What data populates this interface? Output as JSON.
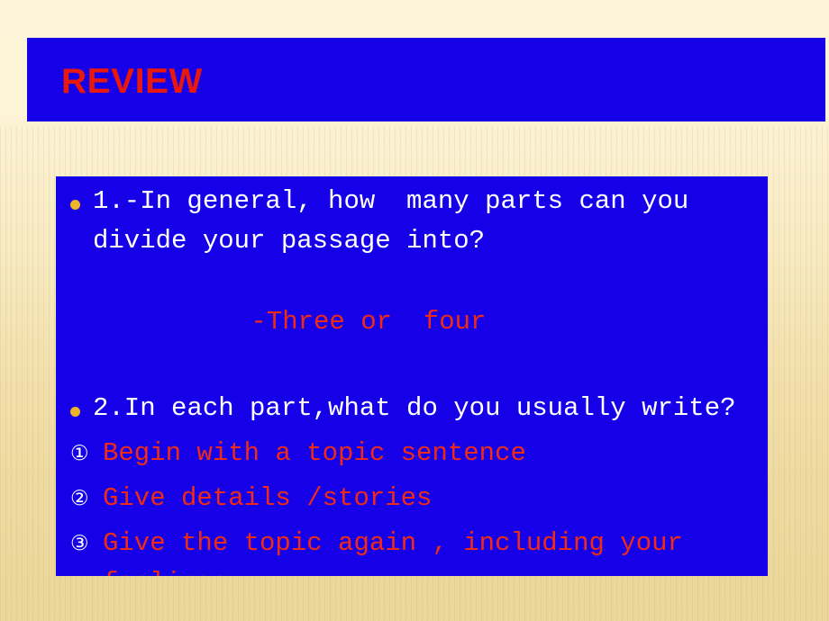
{
  "slide": {
    "title": "REVIEW",
    "colors": {
      "background": "#f5e6bd",
      "panel": "#1500e8",
      "title_text": "#e8180c",
      "body_white": "#ffffff",
      "body_red": "#ef2b16",
      "bullet_dot": "#f0b428"
    },
    "content": {
      "question1": "1.-In general, how  many parts can you divide your passage into?",
      "answer1": "-Three or  four",
      "question2": "2.In each part,what do you usually write?",
      "items": [
        {
          "marker": "①",
          "text": "Begin with a topic sentence"
        },
        {
          "marker": "②",
          "text": "Give details /stories"
        },
        {
          "marker": "③",
          "text": "Give the topic again , including your feelings"
        }
      ]
    }
  }
}
